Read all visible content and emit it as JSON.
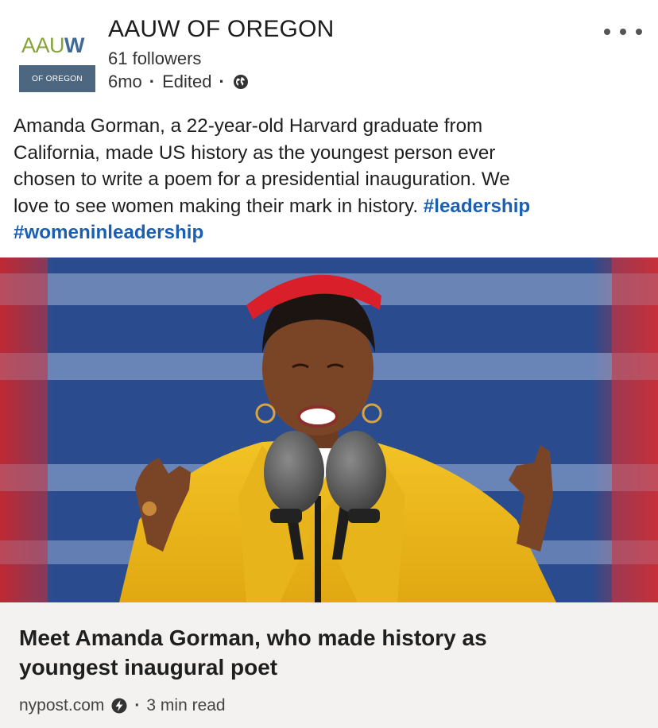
{
  "author": {
    "name": "AAUW OF OREGON",
    "followers": "61 followers",
    "age": "6mo",
    "edited": "Edited",
    "visibility_icon": "globe-icon",
    "logo": {
      "wordmark_main": "AAU",
      "wordmark_accent": "W",
      "subtitle": "OF OREGON"
    }
  },
  "menu": {
    "icon": "more-horizontal-icon"
  },
  "commentary": {
    "lines": [
      "Amanda Gorman, a 22-year-old Harvard graduate from",
      "California, made US history as the youngest person ever",
      "chosen to write a poem for a presidential inauguration. We",
      "love to see women making their mark in history. "
    ],
    "hashtags": [
      "#leadership",
      "#womeninleadership"
    ]
  },
  "article": {
    "title_lines": [
      "Meet Amanda Gorman, who made history as",
      "youngest inaugural poet"
    ],
    "source": "nypost.com",
    "source_icon": "lightning-bolt-icon",
    "read_time": "3 min read"
  },
  "colors": {
    "hashtag": "#1b5fb5",
    "logo_green": "#86a33b",
    "logo_blue": "#3e6b96",
    "logo_plate": "#4d6780",
    "card_bg": "#f3f2f0"
  }
}
